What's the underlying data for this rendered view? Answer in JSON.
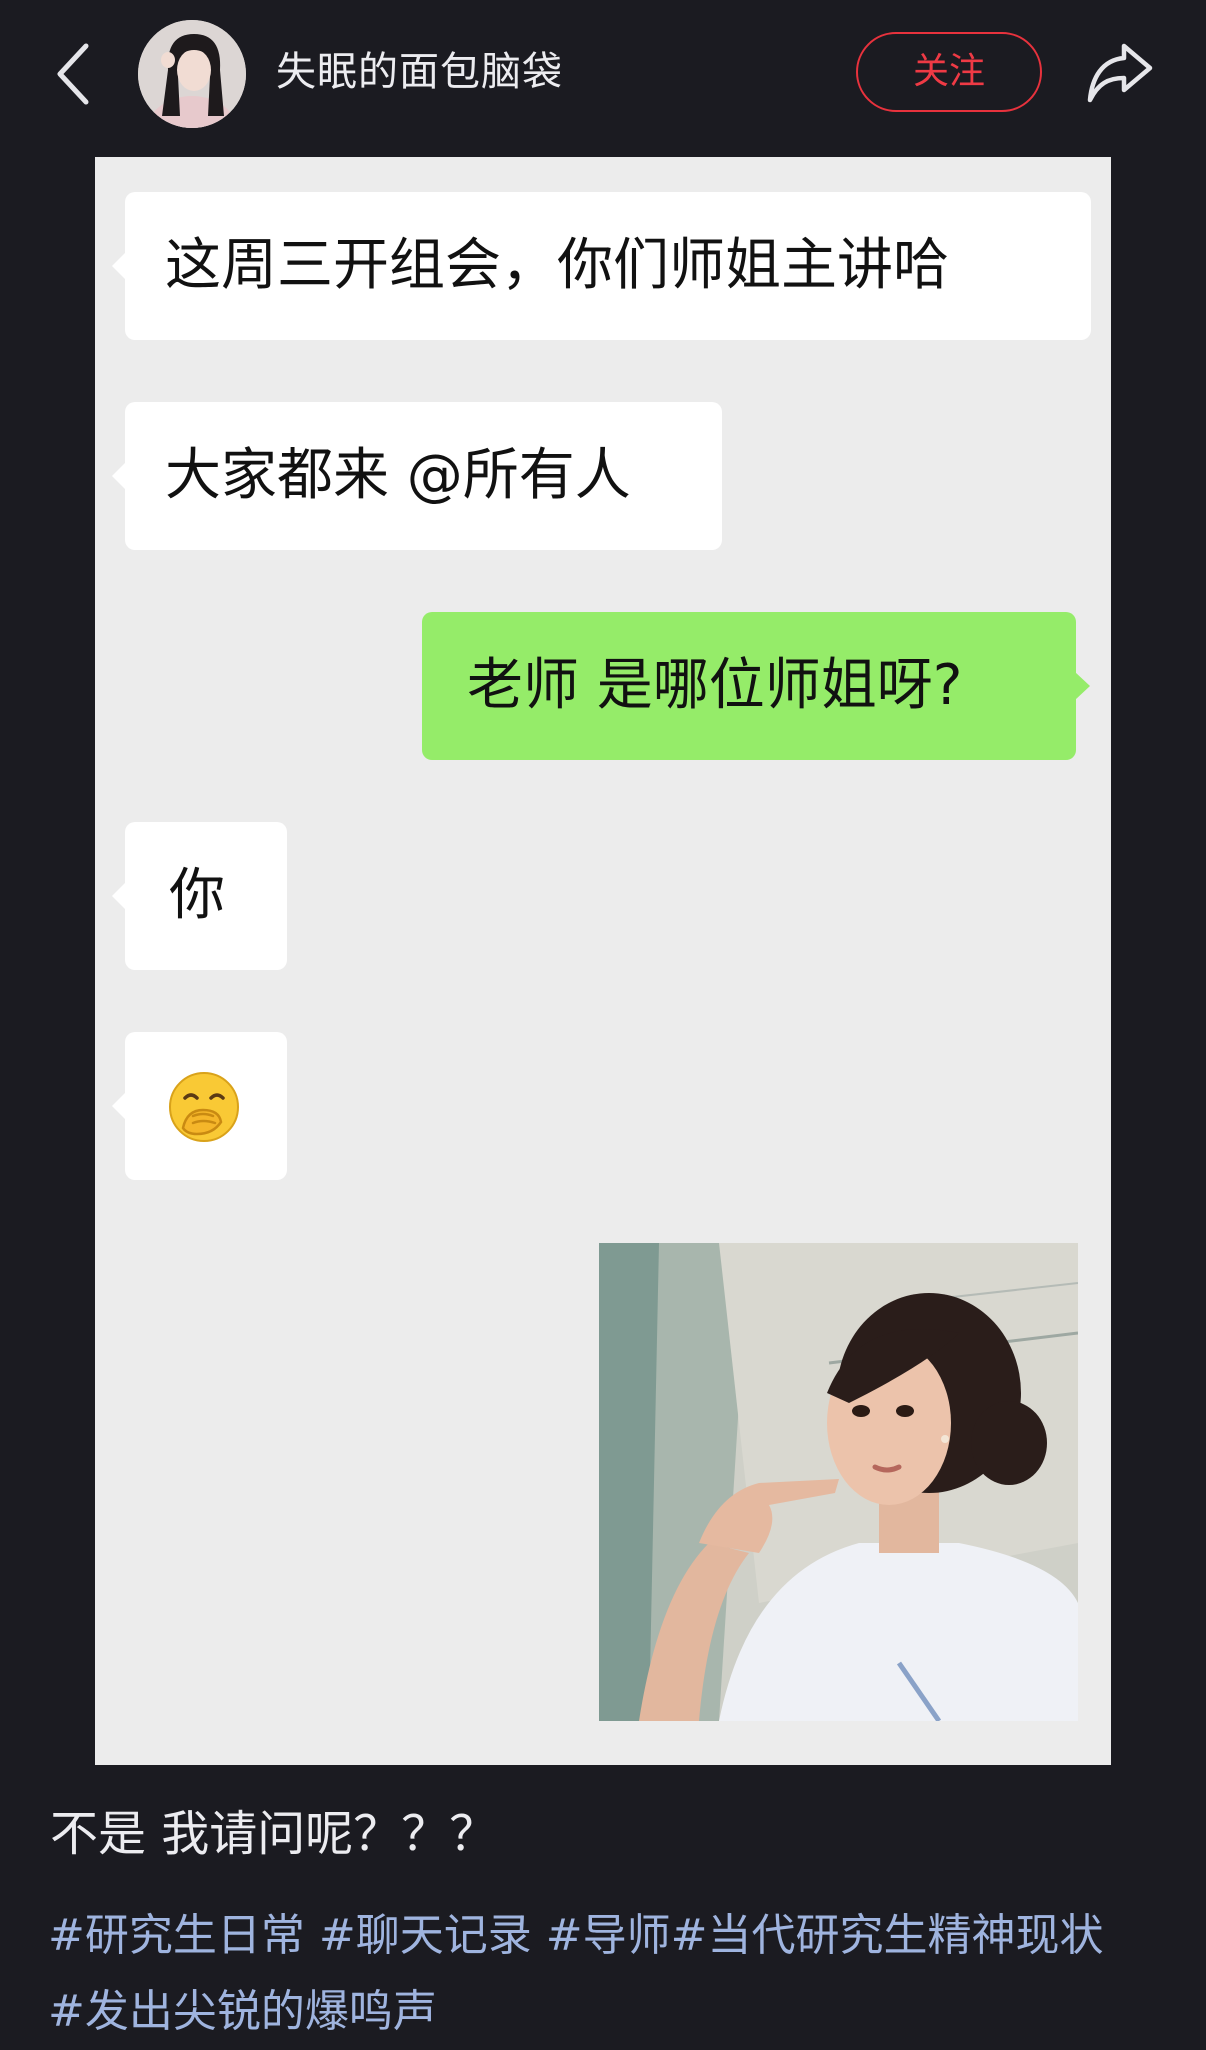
{
  "header": {
    "username": "失眠的面包脑袋",
    "follow_label": "关注",
    "back_icon": "chevron-left-icon",
    "share_icon": "share-arrow-icon",
    "accent_color": "#e8323d"
  },
  "chat": {
    "messages": [
      {
        "side": "left",
        "text": "这周三开组会，你们师姐主讲哈"
      },
      {
        "side": "left",
        "text": "大家都来 @所有人"
      },
      {
        "side": "right",
        "text": "老师 是哪位师姐呀?"
      },
      {
        "side": "left",
        "text": "你"
      },
      {
        "side": "left",
        "emoji": "hand-over-mouth-emoji"
      },
      {
        "side": "right",
        "sticker": "girl-pointing-at-self-sticker"
      }
    ],
    "left_bubble_color": "#ffffff",
    "right_bubble_color": "#95ec69"
  },
  "post": {
    "caption": "不是 我请问呢？？？",
    "tags": [
      "#研究生日常",
      "#聊天记录",
      "#导师",
      "#当代研究生精神现状",
      "#发出尖锐的爆鸣声"
    ],
    "tag_color": "#9fb4df"
  }
}
